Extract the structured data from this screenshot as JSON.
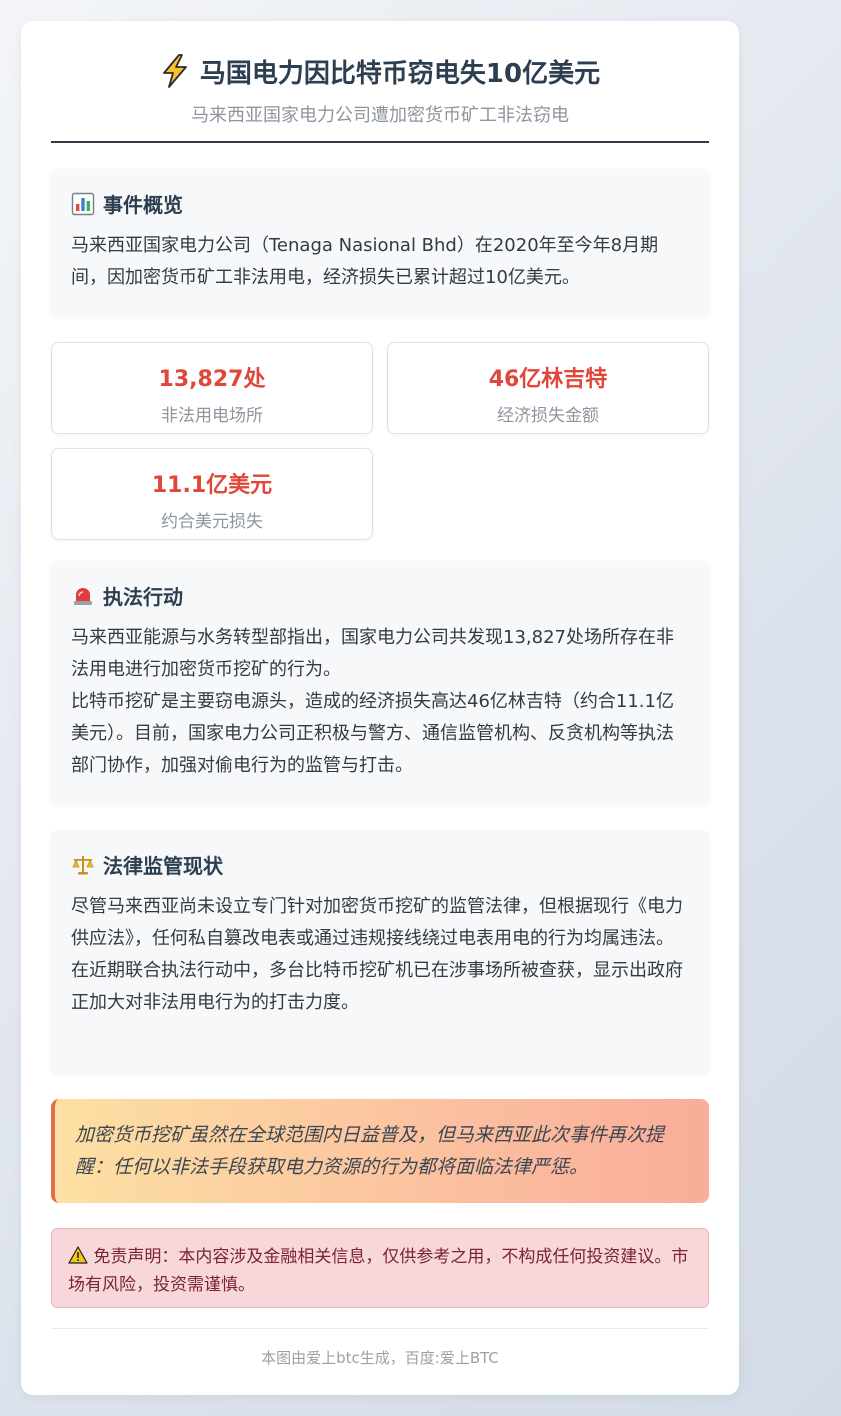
{
  "header": {
    "title": "马国电力因比特币窃电失10亿美元",
    "subtitle": "马来西亚国家电力公司遭加密货币矿工非法窃电"
  },
  "overview": {
    "heading": "事件概览",
    "text": "马来西亚国家电力公司（Tenaga Nasional Bhd）在2020年至今年8月期间，因加密货币矿工非法用电，经济损失已累计超过10亿美元。"
  },
  "stats": [
    {
      "value": "13,827处",
      "label": "非法用电场所"
    },
    {
      "value": "46亿林吉特",
      "label": "经济损失金额"
    },
    {
      "value": "11.1亿美元",
      "label": "约合美元损失"
    }
  ],
  "enforcement": {
    "heading": "执法行动",
    "para1": "马来西亚能源与水务转型部指出，国家电力公司共发现13,827处场所存在非法用电进行加密货币挖矿的行为。",
    "para2": "比特币挖矿是主要窃电源头，造成的经济损失高达46亿林吉特（约合11.1亿美元）。目前，国家电力公司正积极与警方、通信监管机构、反贪机构等执法部门协作，加强对偷电行为的监管与打击。"
  },
  "legal": {
    "heading": "法律监管现状",
    "para1": "尽管马来西亚尚未设立专门针对加密货币挖矿的监管法律，但根据现行《电力供应法》，任何私自篡改电表或通过违规接线绕过电表用电的行为均属违法。",
    "para2": "在近期联合执法行动中，多台比特币挖矿机已在涉事场所被查获，显示出政府正加大对非法用电行为的打击力度。"
  },
  "quote": {
    "text": "加密货币挖矿虽然在全球范围内日益普及，但马来西亚此次事件再次提醒：任何以非法手段获取电力资源的行为都将面临法律严惩。"
  },
  "disclaimer": {
    "text": "免责声明：本内容涉及金融相关信息，仅供参考之用，不构成任何投资建议。市场有风险，投资需谨慎。"
  },
  "footer": {
    "text": "本图由爱上btc生成，百度:爱上BTC"
  },
  "icons": {
    "title": "lightning-bolt-icon",
    "overview": "bar-chart-icon",
    "enforcement": "police-siren-icon",
    "legal": "balance-scale-icon",
    "disclaimer": "warning-icon"
  },
  "colors": {
    "accent_red": "#e0463a",
    "heading": "#2c3e50",
    "quote_border": "#e0704a",
    "disclaimer_bg": "#f8d7da"
  }
}
